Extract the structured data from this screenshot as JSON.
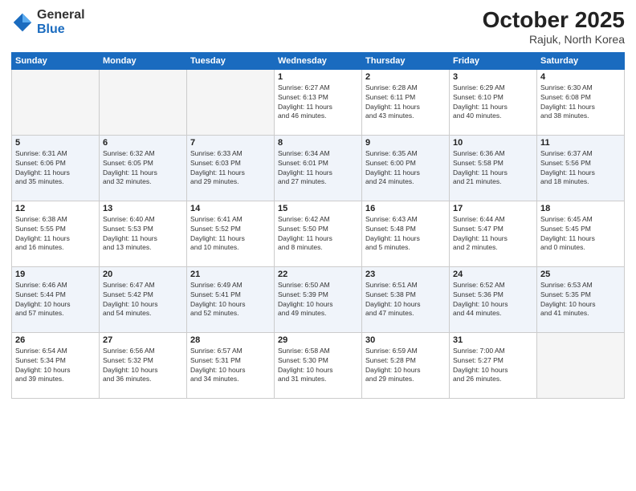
{
  "logo": {
    "general": "General",
    "blue": "Blue"
  },
  "title": "October 2025",
  "location": "Rajuk, North Korea",
  "days_of_week": [
    "Sunday",
    "Monday",
    "Tuesday",
    "Wednesday",
    "Thursday",
    "Friday",
    "Saturday"
  ],
  "weeks": [
    [
      {
        "day": "",
        "info": ""
      },
      {
        "day": "",
        "info": ""
      },
      {
        "day": "",
        "info": ""
      },
      {
        "day": "1",
        "info": "Sunrise: 6:27 AM\nSunset: 6:13 PM\nDaylight: 11 hours\nand 46 minutes."
      },
      {
        "day": "2",
        "info": "Sunrise: 6:28 AM\nSunset: 6:11 PM\nDaylight: 11 hours\nand 43 minutes."
      },
      {
        "day": "3",
        "info": "Sunrise: 6:29 AM\nSunset: 6:10 PM\nDaylight: 11 hours\nand 40 minutes."
      },
      {
        "day": "4",
        "info": "Sunrise: 6:30 AM\nSunset: 6:08 PM\nDaylight: 11 hours\nand 38 minutes."
      }
    ],
    [
      {
        "day": "5",
        "info": "Sunrise: 6:31 AM\nSunset: 6:06 PM\nDaylight: 11 hours\nand 35 minutes."
      },
      {
        "day": "6",
        "info": "Sunrise: 6:32 AM\nSunset: 6:05 PM\nDaylight: 11 hours\nand 32 minutes."
      },
      {
        "day": "7",
        "info": "Sunrise: 6:33 AM\nSunset: 6:03 PM\nDaylight: 11 hours\nand 29 minutes."
      },
      {
        "day": "8",
        "info": "Sunrise: 6:34 AM\nSunset: 6:01 PM\nDaylight: 11 hours\nand 27 minutes."
      },
      {
        "day": "9",
        "info": "Sunrise: 6:35 AM\nSunset: 6:00 PM\nDaylight: 11 hours\nand 24 minutes."
      },
      {
        "day": "10",
        "info": "Sunrise: 6:36 AM\nSunset: 5:58 PM\nDaylight: 11 hours\nand 21 minutes."
      },
      {
        "day": "11",
        "info": "Sunrise: 6:37 AM\nSunset: 5:56 PM\nDaylight: 11 hours\nand 18 minutes."
      }
    ],
    [
      {
        "day": "12",
        "info": "Sunrise: 6:38 AM\nSunset: 5:55 PM\nDaylight: 11 hours\nand 16 minutes."
      },
      {
        "day": "13",
        "info": "Sunrise: 6:40 AM\nSunset: 5:53 PM\nDaylight: 11 hours\nand 13 minutes."
      },
      {
        "day": "14",
        "info": "Sunrise: 6:41 AM\nSunset: 5:52 PM\nDaylight: 11 hours\nand 10 minutes."
      },
      {
        "day": "15",
        "info": "Sunrise: 6:42 AM\nSunset: 5:50 PM\nDaylight: 11 hours\nand 8 minutes."
      },
      {
        "day": "16",
        "info": "Sunrise: 6:43 AM\nSunset: 5:48 PM\nDaylight: 11 hours\nand 5 minutes."
      },
      {
        "day": "17",
        "info": "Sunrise: 6:44 AM\nSunset: 5:47 PM\nDaylight: 11 hours\nand 2 minutes."
      },
      {
        "day": "18",
        "info": "Sunrise: 6:45 AM\nSunset: 5:45 PM\nDaylight: 11 hours\nand 0 minutes."
      }
    ],
    [
      {
        "day": "19",
        "info": "Sunrise: 6:46 AM\nSunset: 5:44 PM\nDaylight: 10 hours\nand 57 minutes."
      },
      {
        "day": "20",
        "info": "Sunrise: 6:47 AM\nSunset: 5:42 PM\nDaylight: 10 hours\nand 54 minutes."
      },
      {
        "day": "21",
        "info": "Sunrise: 6:49 AM\nSunset: 5:41 PM\nDaylight: 10 hours\nand 52 minutes."
      },
      {
        "day": "22",
        "info": "Sunrise: 6:50 AM\nSunset: 5:39 PM\nDaylight: 10 hours\nand 49 minutes."
      },
      {
        "day": "23",
        "info": "Sunrise: 6:51 AM\nSunset: 5:38 PM\nDaylight: 10 hours\nand 47 minutes."
      },
      {
        "day": "24",
        "info": "Sunrise: 6:52 AM\nSunset: 5:36 PM\nDaylight: 10 hours\nand 44 minutes."
      },
      {
        "day": "25",
        "info": "Sunrise: 6:53 AM\nSunset: 5:35 PM\nDaylight: 10 hours\nand 41 minutes."
      }
    ],
    [
      {
        "day": "26",
        "info": "Sunrise: 6:54 AM\nSunset: 5:34 PM\nDaylight: 10 hours\nand 39 minutes."
      },
      {
        "day": "27",
        "info": "Sunrise: 6:56 AM\nSunset: 5:32 PM\nDaylight: 10 hours\nand 36 minutes."
      },
      {
        "day": "28",
        "info": "Sunrise: 6:57 AM\nSunset: 5:31 PM\nDaylight: 10 hours\nand 34 minutes."
      },
      {
        "day": "29",
        "info": "Sunrise: 6:58 AM\nSunset: 5:30 PM\nDaylight: 10 hours\nand 31 minutes."
      },
      {
        "day": "30",
        "info": "Sunrise: 6:59 AM\nSunset: 5:28 PM\nDaylight: 10 hours\nand 29 minutes."
      },
      {
        "day": "31",
        "info": "Sunrise: 7:00 AM\nSunset: 5:27 PM\nDaylight: 10 hours\nand 26 minutes."
      },
      {
        "day": "",
        "info": ""
      }
    ]
  ]
}
